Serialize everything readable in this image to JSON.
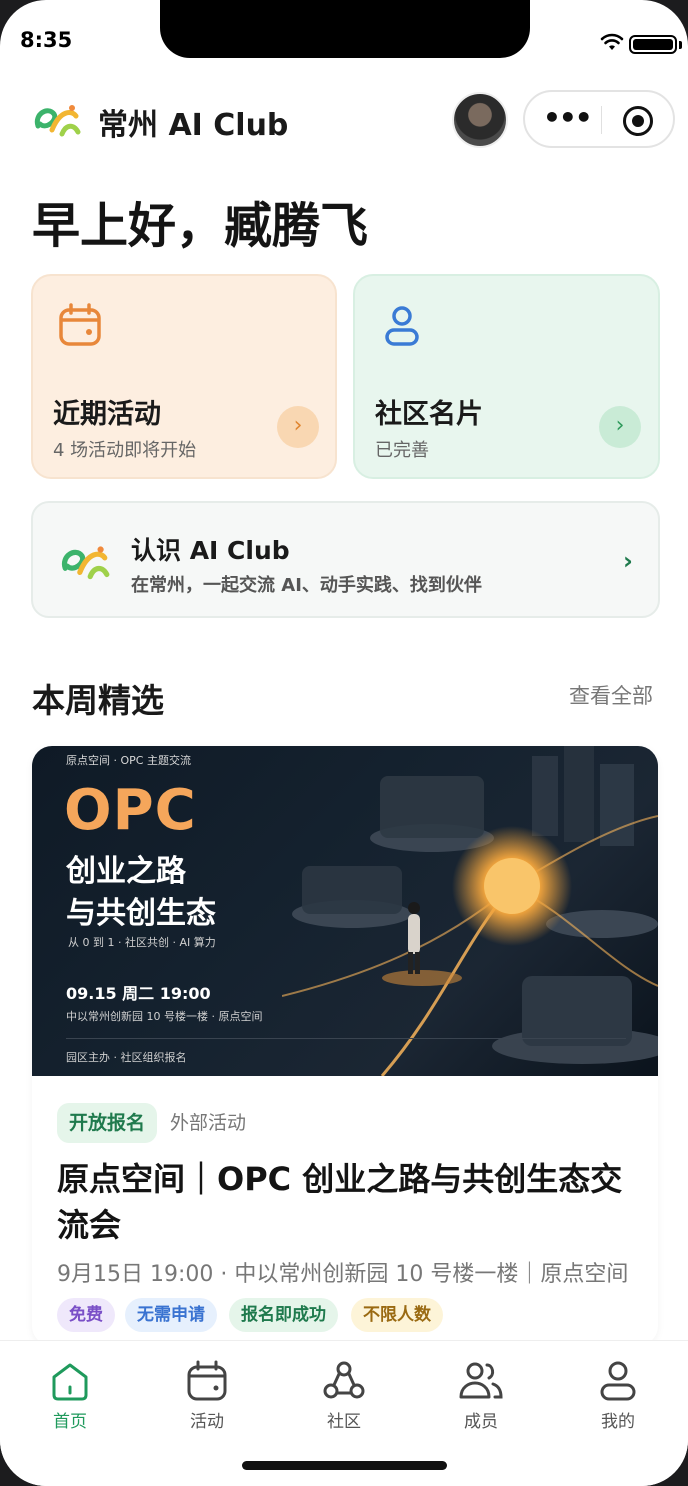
{
  "status_bar": {
    "time": "8:35"
  },
  "header": {
    "app_title": "常州 AI Club"
  },
  "greeting": "早上好，臧腾飞",
  "quick_cards": {
    "events": {
      "title": "近期活动",
      "subtitle": "4 场活动即将开始",
      "accent": "#e0852f"
    },
    "profile": {
      "title": "社区名片",
      "subtitle": "已完善",
      "accent": "#3a73d1"
    }
  },
  "about": {
    "title": "认识 AI Club",
    "subtitle": "在常州，一起交流 AI、动手实践、找到伙伴"
  },
  "section": {
    "title": "本周精选",
    "see_all": "查看全部"
  },
  "featured": {
    "poster": {
      "kicker": "原点空间 · OPC 主题交流",
      "headline": "OPC",
      "title_line1": "创业之路",
      "title_line2": "与共创生态",
      "tagline": "从 0 到 1 · 社区共创 · AI 算力",
      "date": "09.15 周二 19:00",
      "location": "中以常州创新园 10 号楼一楼 · 原点空间",
      "host": "园区主办 · 社区组织报名"
    },
    "status_pill": "开放报名",
    "type_label": "外部活动",
    "title": "原点空间｜OPC 创业之路与共创生态交流会",
    "meta": "9月15日 19:00 · 中以常州创新园 10 号楼一楼｜原点空间",
    "chips": [
      "免费",
      "无需申请",
      "报名即成功",
      "不限人数"
    ]
  },
  "tabbar": {
    "items": [
      {
        "label": "首页",
        "icon": "home-icon",
        "active": true
      },
      {
        "label": "活动",
        "icon": "calendar-icon",
        "active": false
      },
      {
        "label": "社区",
        "icon": "community-icon",
        "active": false
      },
      {
        "label": "成员",
        "icon": "members-icon",
        "active": false
      },
      {
        "label": "我的",
        "icon": "profile-icon",
        "active": false
      }
    ],
    "active_color": "#1f9a5c"
  }
}
